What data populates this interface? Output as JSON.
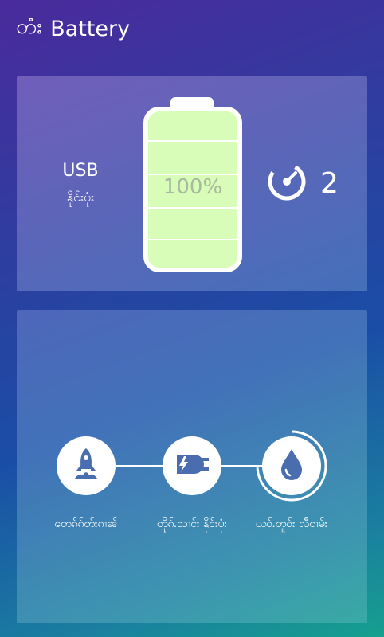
{
  "header": {
    "title": "Battery",
    "prefix": "တံး"
  },
  "status": {
    "source": "USB",
    "source_state": "နိုင်းပုံး",
    "percent": "100%",
    "charge_level": 1.0,
    "boost_count": "2"
  },
  "steps": [
    {
      "label": "တေၵ်ၵ်တ်ႈၵၢၼ်",
      "icon": "rocket-icon"
    },
    {
      "label": "တိုၵ်ႉသၢင်း နိုင်းပုံး",
      "icon": "plug-icon"
    },
    {
      "label": "ယဝ်ႉတူဝ်း လီငၢမ်း",
      "icon": "drop-icon"
    }
  ],
  "colors": {
    "battery_fill": "#d8fdb8",
    "accent_white": "#ffffff",
    "icon_blue": "#4a6db0"
  }
}
